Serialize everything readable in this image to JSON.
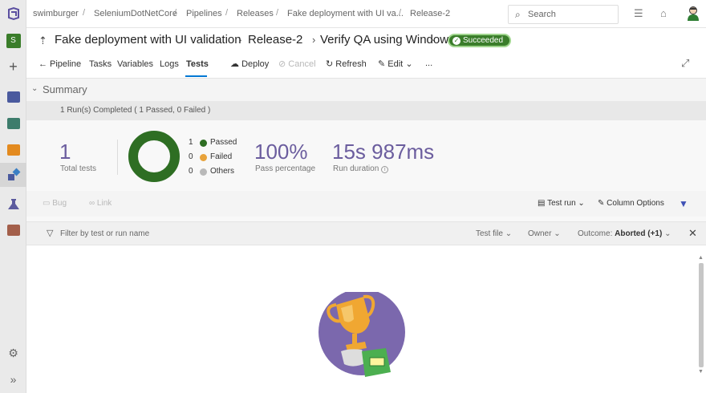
{
  "breadcrumbs": [
    "swimburger",
    "SeleniumDotNetCore",
    "Pipelines",
    "Releases",
    "Fake deployment with UI va...",
    "Release-2"
  ],
  "search": {
    "placeholder": "Search"
  },
  "title": {
    "pipeline": "Fake deployment with UI validation",
    "release": "Release-2",
    "stage": "Verify QA using Windows Agent",
    "status": "Succeeded"
  },
  "tabs": [
    "Pipeline",
    "Tasks",
    "Variables",
    "Logs",
    "Tests"
  ],
  "active_tab": "Tests",
  "actions": {
    "deploy": "Deploy",
    "cancel": "Cancel",
    "refresh": "Refresh",
    "edit": "Edit",
    "more": "..."
  },
  "summary": {
    "title": "Summary",
    "runs_completed": "1 Run(s) Completed ( 1 Passed, 0 Failed )",
    "total_tests": "1",
    "total_tests_label": "Total tests",
    "legend": [
      {
        "count": "1",
        "label": "Passed",
        "color": "#2e6e23"
      },
      {
        "count": "0",
        "label": "Failed",
        "color": "#e8a33b"
      },
      {
        "count": "0",
        "label": "Others",
        "color": "#b9b9b9"
      }
    ],
    "pass_percentage": "100%",
    "pass_percentage_label": "Pass percentage",
    "run_duration": "15s 987ms",
    "run_duration_label": "Run duration"
  },
  "test_toolbar": {
    "bug": "Bug",
    "link": "Link",
    "test_run": "Test run",
    "column_options": "Column Options"
  },
  "filter": {
    "placeholder": "Filter by test or run name",
    "test_file": "Test file",
    "owner": "Owner",
    "outcome_label": "Outcome:",
    "outcome_value": "Aborted (+1)"
  },
  "colors": {
    "accent": "#0078d4",
    "success": "#2e6e23",
    "purple": "#6b5d9e"
  }
}
